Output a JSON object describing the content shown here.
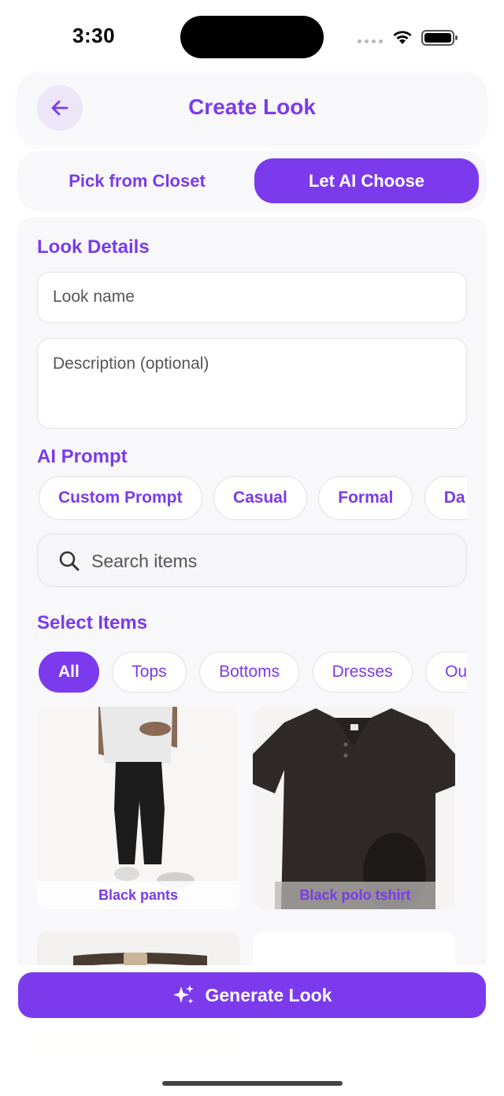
{
  "status_bar": {
    "time": "3:30"
  },
  "header": {
    "title": "Create Look"
  },
  "segmented": {
    "left_label": "Pick from Closet",
    "right_label": "Let AI Choose"
  },
  "look_details": {
    "title": "Look Details",
    "name_placeholder": "Look name",
    "description_placeholder": "Description (optional)"
  },
  "ai_prompt": {
    "title": "AI Prompt",
    "chips": [
      "Custom Prompt",
      "Casual",
      "Formal",
      "Da"
    ]
  },
  "search": {
    "placeholder": "Search items"
  },
  "select_items": {
    "title": "Select Items",
    "categories": [
      "All",
      "Tops",
      "Bottoms",
      "Dresses",
      "Ou"
    ],
    "active_category": "All",
    "items": [
      {
        "label": "Black pants"
      },
      {
        "label": "Black polo tshirt"
      }
    ]
  },
  "generate_button": {
    "label": "Generate Look",
    "icon": "sparkles-icon"
  },
  "colors": {
    "accent": "#7c3aed",
    "text_accent": "#7b3bea"
  }
}
